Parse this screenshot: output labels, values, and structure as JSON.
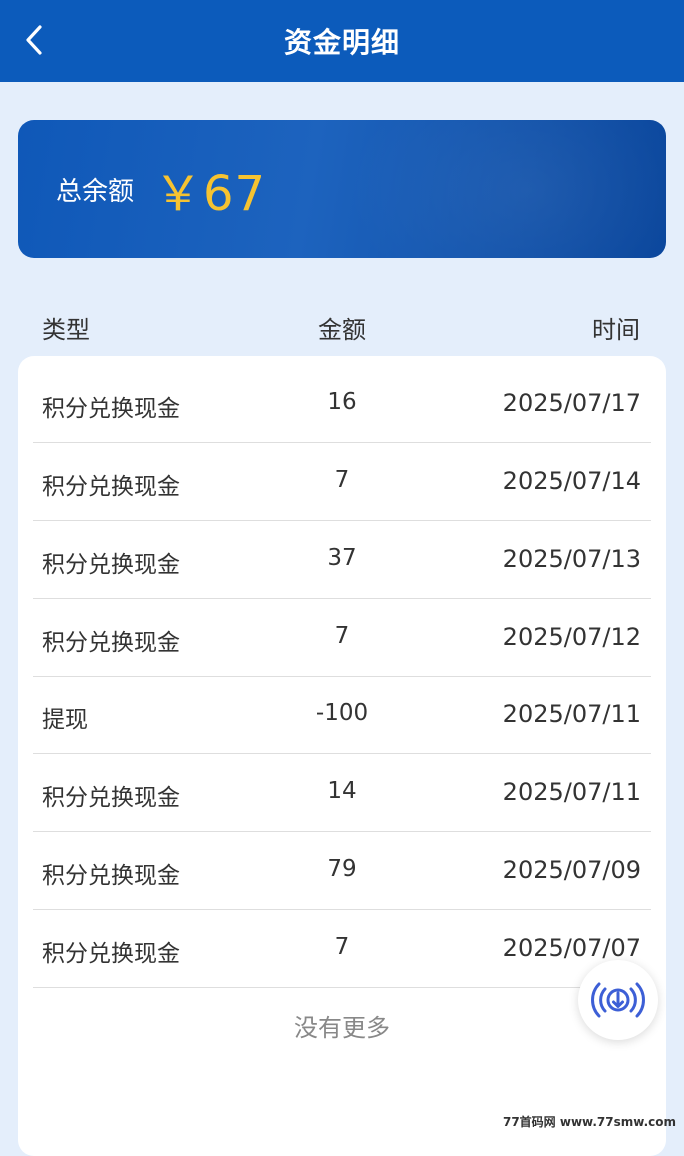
{
  "header": {
    "title": "资金明细"
  },
  "balance": {
    "label": "总余额",
    "value": "￥67"
  },
  "columns": {
    "type": "类型",
    "amount": "金额",
    "time": "时间"
  },
  "rows": [
    {
      "type": "积分兑换现金",
      "amount": "16",
      "time": "2025/07/17"
    },
    {
      "type": "积分兑换现金",
      "amount": "7",
      "time": "2025/07/14"
    },
    {
      "type": "积分兑换现金",
      "amount": "37",
      "time": "2025/07/13"
    },
    {
      "type": "积分兑换现金",
      "amount": "7",
      "time": "2025/07/12"
    },
    {
      "type": "提现",
      "amount": "-100",
      "time": "2025/07/11"
    },
    {
      "type": "积分兑换现金",
      "amount": "14",
      "time": "2025/07/11"
    },
    {
      "type": "积分兑换现金",
      "amount": "79",
      "time": "2025/07/09"
    },
    {
      "type": "积分兑换现金",
      "amount": "7",
      "time": "2025/07/07"
    }
  ],
  "footer": {
    "no_more": "没有更多"
  },
  "watermark": "77首码网 www.77smw.com",
  "colors": {
    "header": "#0c5bbb",
    "accent_gold": "#f6c331",
    "page_bg": "#e4eefb",
    "float_icon": "#3d5fd6"
  },
  "icons": {
    "back": "chevron-left-icon",
    "float": "download-signal-icon"
  }
}
